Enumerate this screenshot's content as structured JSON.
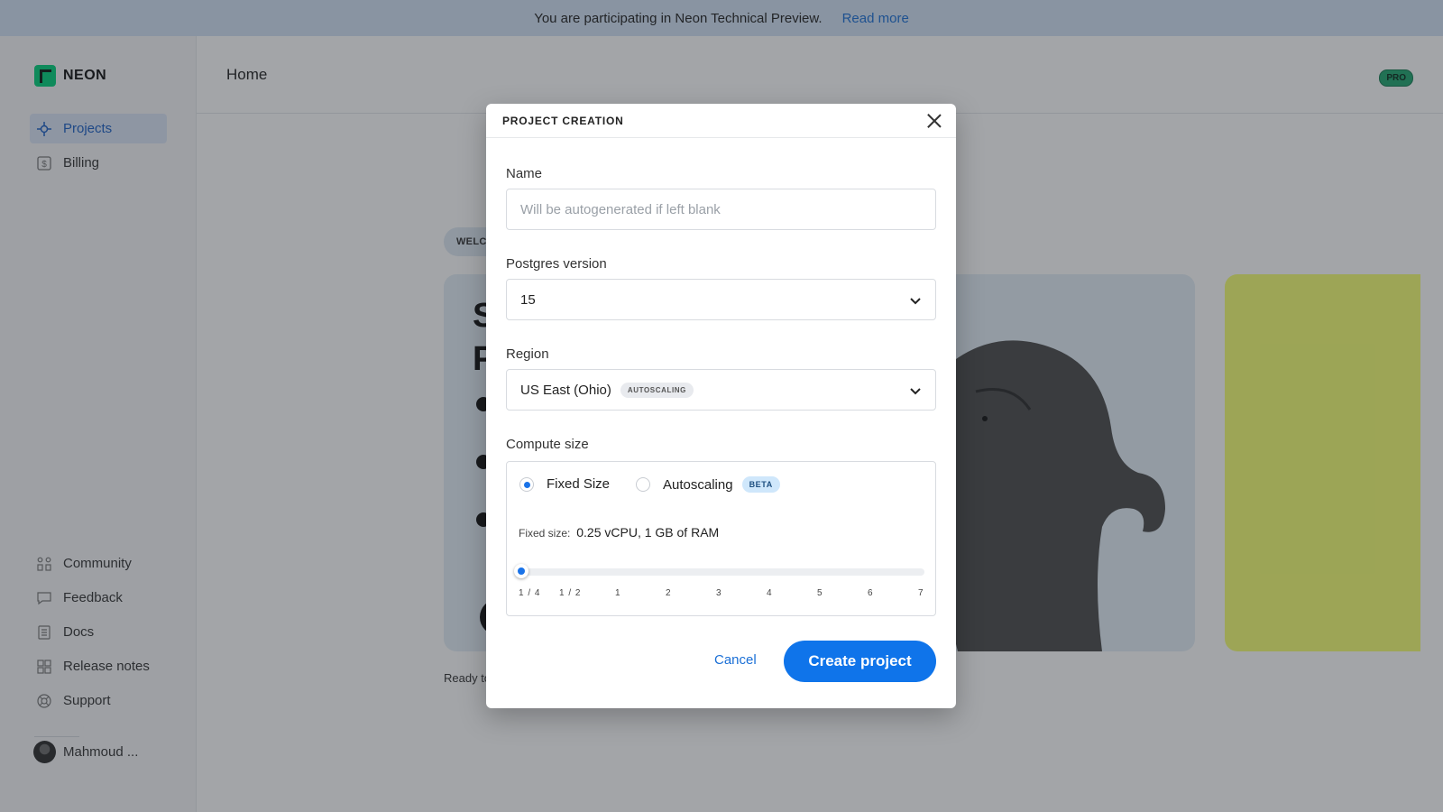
{
  "banner": {
    "message": "You are participating in Neon Technical Preview.",
    "link_label": "Read more"
  },
  "app": {
    "logo_text": "NEON"
  },
  "sidebar": {
    "top_items": [
      {
        "label": "Projects",
        "icon": "projects-icon",
        "active": true
      },
      {
        "label": "Billing",
        "icon": "billing-icon",
        "active": false
      }
    ],
    "bottom_items": [
      {
        "label": "Community",
        "icon": "community-icon"
      },
      {
        "label": "Feedback",
        "icon": "feedback-icon"
      },
      {
        "label": "Docs",
        "icon": "docs-icon"
      },
      {
        "label": "Release notes",
        "icon": "release-notes-icon"
      },
      {
        "label": "Support",
        "icon": "support-icon"
      }
    ],
    "user": {
      "name": "Mahmoud ..."
    }
  },
  "header": {
    "title": "Home",
    "plan_badge": "PRO"
  },
  "background": {
    "welcome_tag": "WELCOME",
    "hero_letters": [
      "S",
      "P"
    ],
    "ready_text": "Ready to"
  },
  "modal": {
    "title": "PROJECT CREATION",
    "name": {
      "label": "Name",
      "placeholder": "Will be autogenerated if left blank",
      "value": ""
    },
    "postgres": {
      "label": "Postgres version",
      "value": "15"
    },
    "region": {
      "label": "Region",
      "value": "US East (Ohio)",
      "tag": "AUTOSCALING"
    },
    "compute": {
      "label": "Compute size",
      "options": [
        {
          "label": "Fixed Size",
          "selected": true
        },
        {
          "label": "Autoscaling",
          "selected": false,
          "tag": "BETA"
        }
      ],
      "fixed_prefix": "Fixed size:",
      "fixed_value": "0.25 vCPU, 1 GB of RAM",
      "slider_ticks": [
        "1 / 4",
        "1 / 2",
        "1",
        "2",
        "3",
        "4",
        "5",
        "6",
        "7"
      ],
      "slider_value": "1 / 4"
    },
    "cancel_label": "Cancel",
    "create_label": "Create project"
  },
  "colors": {
    "accent": "#0f74ea",
    "brand": "#00d17a",
    "banner_bg": "#d2e2f4",
    "yellow_card": "#f4ff72"
  }
}
